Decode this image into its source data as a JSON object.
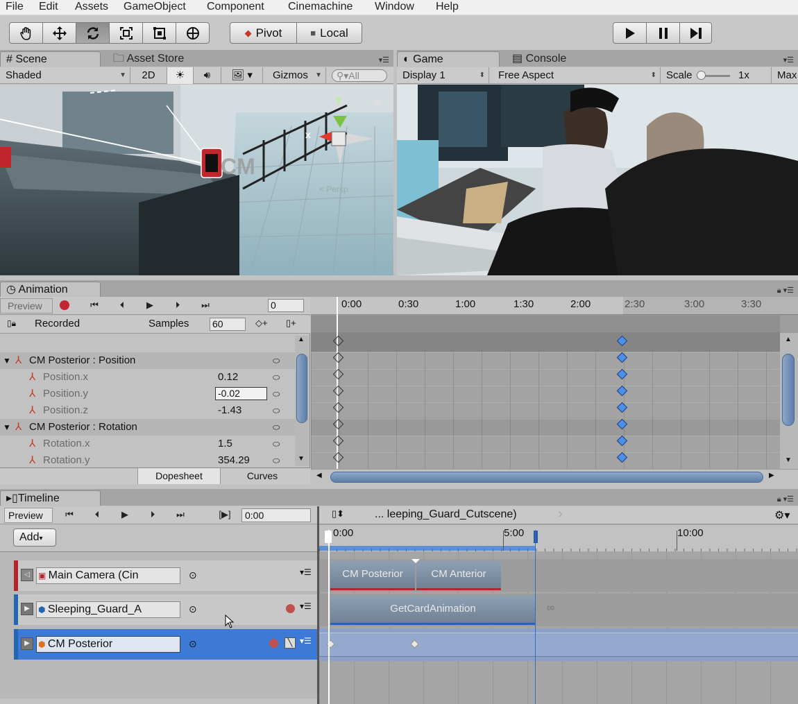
{
  "menu": [
    "File",
    "Edit",
    "Assets",
    "GameObject",
    "Component",
    "Cinemachine",
    "Window",
    "Help"
  ],
  "toolbar": {
    "tools": [
      "hand-icon",
      "move-icon",
      "rotate-icon",
      "scale-icon",
      "rect-icon",
      "transform-icon"
    ],
    "pivot_label": "Pivot",
    "local_label": "Local",
    "play_icons": [
      "▶",
      "❚❚",
      "▶❚"
    ]
  },
  "scene": {
    "tab_scene": "Scene",
    "tab_store": "Asset Store",
    "shading": "Shaded",
    "mode_2d": "2D",
    "gizmos": "Gizmos",
    "search_placeholder": "All",
    "gizmo_y": "y",
    "gizmo_x": "x",
    "persp": "< Persp",
    "cm_label": "CM"
  },
  "game": {
    "tab_game": "Game",
    "tab_console": "Console",
    "display": "Display 1",
    "aspect": "Free Aspect",
    "scale_label": "Scale",
    "scale_value": "1x",
    "max_label": "Max"
  },
  "animation": {
    "tab": "Animation",
    "preview": "Preview",
    "frame": "0",
    "clip": "Recorded",
    "samples_label": "Samples",
    "samples_value": "60",
    "properties": [
      {
        "name": "CM Posterior : Position",
        "value": "",
        "group": true
      },
      {
        "name": "Position.x",
        "value": "0.12",
        "group": false
      },
      {
        "name": "Position.y",
        "value": "-0.02",
        "group": false
      },
      {
        "name": "Position.z",
        "value": "-1.43",
        "group": false
      },
      {
        "name": "CM Posterior : Rotation",
        "value": "",
        "group": true
      },
      {
        "name": "Rotation.x",
        "value": "1.5",
        "group": false
      },
      {
        "name": "Rotation.y",
        "value": "354.29",
        "group": false
      }
    ],
    "ruler": [
      "0:00",
      "0:30",
      "1:00",
      "1:30",
      "2:00",
      "2:30",
      "3:00",
      "3:30"
    ],
    "tab_dopesheet": "Dopesheet",
    "tab_curves": "Curves"
  },
  "timeline": {
    "tab": "Timeline",
    "preview": "Preview",
    "time": "0:00",
    "asset": "... leeping_Guard_Cutscene)",
    "add_label": "Add",
    "ruler": [
      "0:00",
      "5:00",
      "10:00"
    ],
    "tracks": [
      {
        "name": "Main Camera (Cin",
        "color": "#b0262e"
      },
      {
        "name": "Sleeping_Guard_A",
        "color": "#2566b3"
      },
      {
        "name": "CM Posterior",
        "color": "#2566b3"
      }
    ],
    "clips": {
      "cam1": "CM Posterior",
      "cam2": "CM Anterior",
      "anim": "GetCardAnimation"
    }
  }
}
